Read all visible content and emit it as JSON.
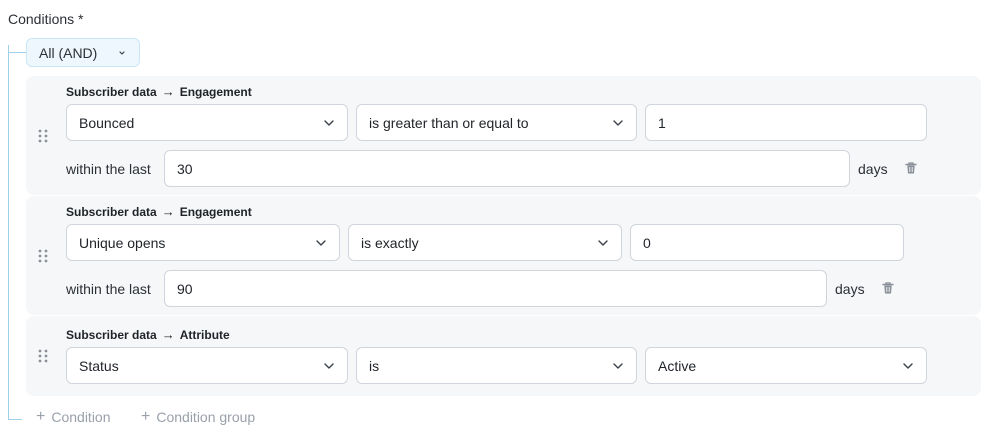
{
  "conditions_label": "Conditions *",
  "logic": {
    "label": "All (AND)"
  },
  "conditions": [
    {
      "category": "Subscriber data",
      "subcategory": "Engagement",
      "field": "Bounced",
      "operator": "is greater than or equal to",
      "value": "1",
      "within_label": "within the last",
      "within_value": "30",
      "unit": "days"
    },
    {
      "category": "Subscriber data",
      "subcategory": "Engagement",
      "field": "Unique opens",
      "operator": "is exactly",
      "value": "0",
      "within_label": "within the last",
      "within_value": "90",
      "unit": "days"
    },
    {
      "category": "Subscriber data",
      "subcategory": "Attribute",
      "field": "Status",
      "operator": "is",
      "value": "Active"
    }
  ],
  "path_arrow": "→",
  "add": {
    "condition": "Condition",
    "condition_group": "Condition group",
    "plus": "+"
  },
  "icons": {
    "drag": "drag-handle-icon",
    "chevron": "chevron-down-icon",
    "trash": "trash-icon"
  },
  "colors": {
    "tree_line": "#9ed0ea",
    "logic_bg": "#eef7fd",
    "card_bg": "#f6f7f9",
    "muted": "#9aa1aa"
  }
}
